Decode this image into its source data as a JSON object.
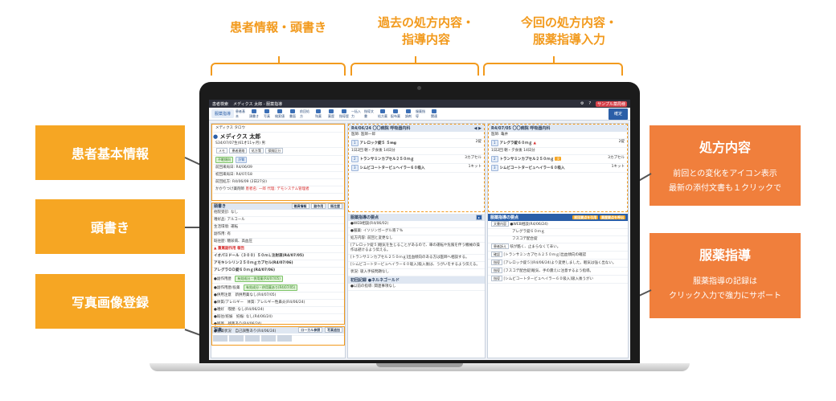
{
  "top_labels": {
    "left": "患者情報・頭書き",
    "middle_1": "過去の処方内容・",
    "middle_2": "指導内容",
    "right_1": "今回の処方内容・",
    "right_2": "服薬指導入力"
  },
  "left_boxes": [
    "患者基本情報",
    "頭書き",
    "写真画像登録"
  ],
  "right_boxes": {
    "prescription": {
      "title": "処方内容",
      "line1": "前回との変化をアイコン表示",
      "line2": "最新の添付文書も１クリックで"
    },
    "guidance": {
      "title": "服薬指導",
      "line1": "服薬指導の記録は",
      "line2": "クリック入力で強力にサポート"
    }
  },
  "colors": {
    "accent_orange": "#f29a1d",
    "box_yellow": "#f6a623",
    "box_orange": "#f07f3c",
    "app_blue": "#2b5fa8"
  },
  "app": {
    "titlebar": {
      "app_name": "患者検索",
      "breadcrumb": "メディクス 太郎 - 服薬指導",
      "pharmacy": "サンプル薬局様"
    },
    "toolbar": {
      "tab": "服薬指導",
      "tools": [
        "患者基本",
        "頭書き",
        "写真",
        "検索値",
        "書面",
        "前回処方",
        "残薬",
        "薬歴",
        "指導歴",
        "一括入力",
        "指導文書",
        "処方薬",
        "配布薬",
        "調剤",
        "服薬指導",
        "関連"
      ],
      "primary": "確定"
    },
    "patient": {
      "kana": "メディクス タロウ",
      "name": "メディクス 太郎",
      "birth": "S34/07/07生(61才11ヶ月)",
      "gender": "男",
      "tags": [
        "メモ",
        "患者連絡",
        "処方箋",
        "保険区分"
      ],
      "badges": [
        "不眠傾向",
        "肝腎"
      ],
      "last_visit": "前回来局日: R4/06/09",
      "first_visit": "初回来局日: R4/07/18",
      "note": "かかりつけ薬剤師",
      "insurance": "前回処方: R4/06/09 (2日27分)",
      "dispense": "代理: デモシステム管理者",
      "warn": "患者名: 一郎"
    },
    "header_panel": {
      "title": "頭書き",
      "buttons": [
        "職員情報",
        "副作用",
        "既往歴"
      ],
      "rows": [
        "他院受診: なし",
        "嗜好品: アルコール",
        "生活環境: 運転",
        "副作用: 有",
        "既往歴: 糖尿病、高血圧"
      ],
      "alert": "重篤副作用 報告",
      "drugs": [
        "イオパミドール（３００）５０ｍＬ注射液(R4/07/05)",
        "アモキシシリン２５０ｍｇカプセル(R4/07/06)",
        "アレグラＯＤ錠６０ｍｇ(R4/07/06)"
      ],
      "items": [
        {
          "k": "●副作用歴",
          "v": "有効成分・併用薬(R4/07/05)"
        },
        {
          "k": "●副作用歴/投薬",
          "v": "有効成分・併用薬あり(R4/07/05)"
        },
        {
          "k": "●併用注意",
          "v": "新併用薬なし(R4/07/05)"
        },
        {
          "k": "●体質/アレルギー",
          "v": "体質: アレルギー性鼻炎(R4/06/24)"
        },
        {
          "k": "●嗜好",
          "v": "喫煙: なし(R4/06/24)"
        },
        {
          "k": "●既往/妊娠",
          "v": "妊娠: なし(R4/06/24)"
        },
        {
          "k": "●残薬",
          "v": "残薬あり(R4/06/24)"
        },
        {
          "k": "●服薬状況",
          "v": "自己調整あり(R4/06/24)"
        }
      ]
    },
    "photo": {
      "title": "写真",
      "btn1": "ローカル参照",
      "btn2": "写真追加"
    },
    "past": {
      "date": "R4/06/24",
      "clinic": "〇〇病院 呼吸器内科",
      "doctor": "医師: 医師一郎",
      "drugs": [
        {
          "no": "1",
          "name": "アレロック錠５ ５mg",
          "qty": "2錠",
          "warn": ""
        },
        {
          "no": "2",
          "name": "トランサミンカプセル２５０ｍｇ",
          "qty": "3カプセル",
          "warn": ""
        },
        {
          "no": "3",
          "name": "シムビコートタービュヘイラー６０吸入",
          "qty": "1キット",
          "warn": ""
        }
      ],
      "note": "1日2回 朝・夕食後 14日分"
    },
    "past_guidance": {
      "title": "服薬指導の要点",
      "lines": [
        "●WEB相談(R4/06/02)",
        "●服薬: イソジンガーグル液７%",
        "処方内容: 前回と変更なし",
        "[アレロック錠５]眠気を生じることがあるので、車の運転や危険を伴う機械の操作は避けるよう伝える。",
        "[トランサミンカプセル２５０ｍｇ]出血傾向のある方は医師へ相談する。",
        "[シムビコートタービュヘイラー６０吸入]吸入後は、うがいをするよう伝える。",
        "状況: 吸入手技問題なし"
      ],
      "footer": "初回記録 ●ネルネゴールド",
      "footer2": "●以前の指導: 関連事項なし"
    },
    "current": {
      "date": "R4/07/05",
      "clinic": "〇〇病院 呼吸器内科",
      "doctor": "医師: 亀井",
      "drugs": [
        {
          "no": "1",
          "name": "アレグラ錠６０ｍｇ",
          "qty": "2錠",
          "warn": "▲"
        },
        {
          "no": "2",
          "name": "トランサミンカプセル２５０ｍｇ",
          "qty": "3カプセル",
          "warn": ""
        },
        {
          "no": "3",
          "name": "シムビコートタービュヘイラー６０吸入",
          "qty": "1キット",
          "warn": ""
        }
      ],
      "note": "1日2回 朝・夕食後 14日分"
    },
    "guidance_input": {
      "title": "服薬指導の要点",
      "btns": [
        "前回要点を引用",
        "薬歴要点を呼出"
      ],
      "rows": [
        {
          "k": "文書内容",
          "v": "●WEB相談(R4/06/24)"
        },
        {
          "k": "",
          "v": "アレグラ錠６０ｍｇ"
        },
        {
          "k": "",
          "v": "フスコデ配合錠"
        },
        {
          "k": "患者訴え",
          "v": "咳が酷く、止まらなくて辛い。"
        },
        {
          "k": "確認",
          "v": "[トランサミンカプセル２５０ｍｇ]出血傾向の確認"
        },
        {
          "k": "指導",
          "v": "[アレロック錠５](R4/06/24)より変更しました。眠気は強く出ない。"
        },
        {
          "k": "指導",
          "v": "[フスコデ配合錠]眠気、手の震えに注意するよう指導。"
        },
        {
          "k": "指導",
          "v": "[シムビコートタービュヘイラー６０吸入]吸入後うがい"
        }
      ]
    }
  }
}
